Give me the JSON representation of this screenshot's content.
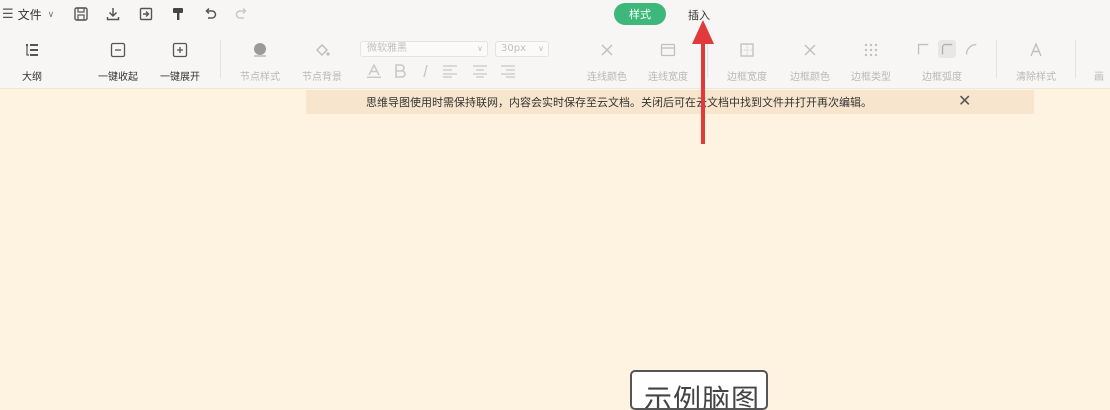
{
  "menu": {
    "file_label": "文件"
  },
  "tabs": {
    "style_label": "样式",
    "insert_label": "插入"
  },
  "toolbar": {
    "outline_label": "大纲",
    "collapse_all_label": "一键收起",
    "expand_all_label": "一键展开",
    "node_style_label": "节点样式",
    "node_background_label": "节点背景",
    "font_family_value": "微软雅黑",
    "font_size_value": "30px",
    "connector_color_label": "连线颜色",
    "connector_width_label": "连线宽度",
    "border_width_label": "边框宽度",
    "border_color_label": "边框颜色",
    "border_type_label": "边框类型",
    "border_radius_label": "边框弧度",
    "clear_style_label": "清除样式",
    "cut_off_label": "画"
  },
  "notice": {
    "text": "思维导图使用时需保持联网，内容会实时保存至云文档。关闭后可在云文档中找到文件并打开再次编辑。"
  },
  "canvas": {
    "root_node_text": "示例脑图"
  },
  "colors": {
    "accent": "#3db87a",
    "canvas_bg": "#fdf3e0",
    "notice_bg": "#f7e6cd",
    "arrow": "#e03a3a"
  }
}
